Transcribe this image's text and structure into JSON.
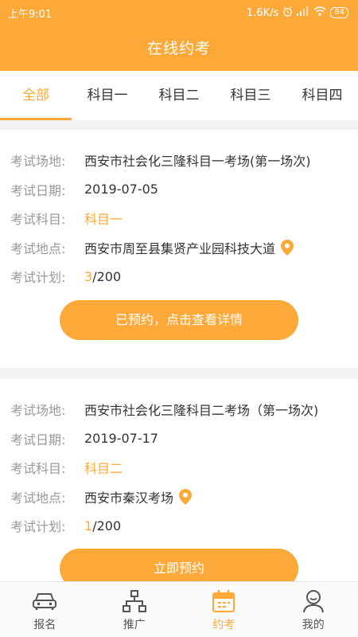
{
  "status_bar": {
    "time": "上午9:01",
    "network_speed": "1.6K/s",
    "battery": "84"
  },
  "header": {
    "title": "在线约考"
  },
  "tabs": [
    {
      "label": "全部",
      "active": true
    },
    {
      "label": "科目一",
      "active": false
    },
    {
      "label": "科目二",
      "active": false
    },
    {
      "label": "科目三",
      "active": false
    },
    {
      "label": "科目四",
      "active": false
    }
  ],
  "labels": {
    "venue": "考试场地:",
    "date": "考试日期:",
    "subject": "考试科目:",
    "location": "考试地点:",
    "plan": "考试计划:"
  },
  "exams": [
    {
      "venue": "西安市社会化三隆科目一考场(第一场次)",
      "date": "2019-07-05",
      "subject": "科目一",
      "location": "西安市周至县集贤产业园科技大道",
      "plan_booked": "3",
      "plan_total": "/200",
      "button_label": "已预约，点击查看详情"
    },
    {
      "venue": "西安市社会化三隆科目二考场（第一场次)",
      "date": "2019-07-17",
      "subject": "科目二",
      "location": "西安市秦汉考场",
      "plan_booked": "1",
      "plan_total": "/200",
      "button_label": "立即预约"
    }
  ],
  "bottom_nav": [
    {
      "label": "报名",
      "icon": "car-icon"
    },
    {
      "label": "推广",
      "icon": "network-icon"
    },
    {
      "label": "约考",
      "icon": "calendar-icon",
      "active": true
    },
    {
      "label": "我的",
      "icon": "user-icon"
    }
  ],
  "colors": {
    "accent": "#fda939",
    "label_gray": "#999999",
    "text": "#333333"
  }
}
